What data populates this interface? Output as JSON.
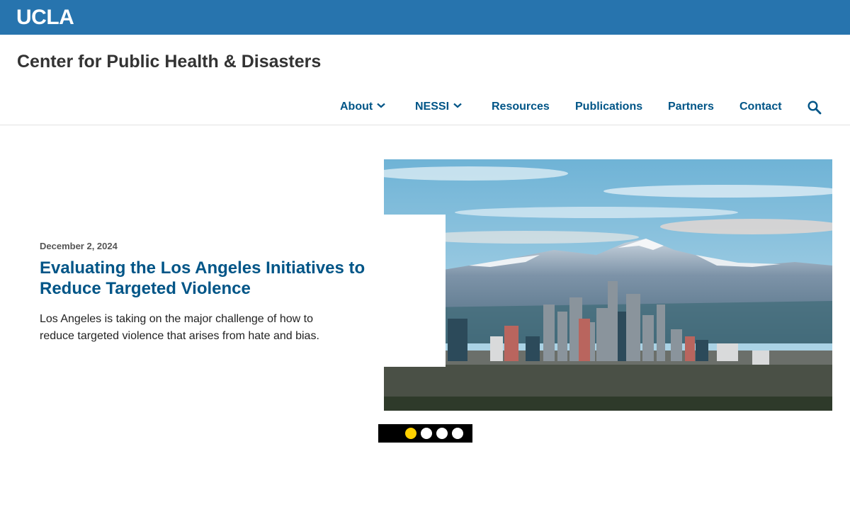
{
  "brand": {
    "logo_text": "UCLA",
    "bar_color": "#2774ae"
  },
  "site": {
    "title": "Center for Public Health & Disasters"
  },
  "nav": {
    "items": [
      {
        "label": "About",
        "has_dropdown": true
      },
      {
        "label": "NESSI",
        "has_dropdown": true
      },
      {
        "label": "Resources",
        "has_dropdown": false
      },
      {
        "label": "Publications",
        "has_dropdown": false
      },
      {
        "label": "Partners",
        "has_dropdown": false
      },
      {
        "label": "Contact",
        "has_dropdown": false
      }
    ],
    "search_icon": "search-icon",
    "link_color": "#005587"
  },
  "slide": {
    "date": "December 2, 2024",
    "title": "Evaluating the Los Angeles Initiatives to Reduce Targeted Violence",
    "text": "Los Angeles is taking on the major challenge of how to reduce targeted violence that arises from hate and bias.",
    "image": "los-angeles-skyline-with-snowy-mountains"
  },
  "carousel": {
    "slide_count": 4,
    "active_index": 1,
    "active_color": "#ffd100"
  }
}
